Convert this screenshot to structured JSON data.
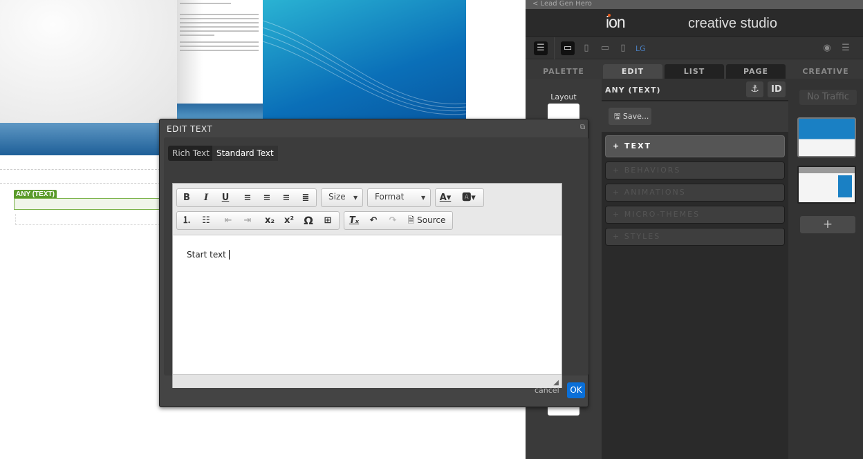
{
  "canvas": {
    "element_label": "ANY (TEXT)"
  },
  "sidebar": {
    "back_link": "< Lead Gen Hero",
    "logo": "ion",
    "app_title": "creative studio",
    "breakpoint": "LG",
    "device_icons": [
      "desktop-icon",
      "tablet-icon",
      "tablet-landscape-icon",
      "phone-icon"
    ],
    "tabs": [
      {
        "label": "PALETTE"
      },
      {
        "label": "EDIT"
      },
      {
        "label": "LIST"
      },
      {
        "label": "PAGE"
      },
      {
        "label": "CREATIVE"
      }
    ],
    "palette": {
      "layout_label": "Layout"
    },
    "edit": {
      "title": "ANY (TEXT)",
      "id_button": "ID",
      "save_label": "Save...",
      "sections": [
        {
          "label": "+ TEXT"
        },
        {
          "label": "+ BEHAVIORS"
        },
        {
          "label": "+ ANIMATIONS"
        },
        {
          "label": "+ MICRO-THEMES"
        },
        {
          "label": "+ STYLES"
        }
      ]
    },
    "creative": {
      "traffic_label": "No Traffic",
      "add_label": "+"
    }
  },
  "dialog": {
    "title": "EDIT TEXT",
    "tabs": [
      {
        "label": "Rich Text"
      },
      {
        "label": "Standard Text"
      }
    ],
    "toolbar": {
      "size_label": "Size",
      "format_label": "Format",
      "source_label": "Source"
    },
    "content": "Start text",
    "cancel_label": "cancel",
    "ok_label": "OK"
  },
  "colors": {
    "accent": "#0a6fd8",
    "label_green": "#5b9b2b"
  }
}
